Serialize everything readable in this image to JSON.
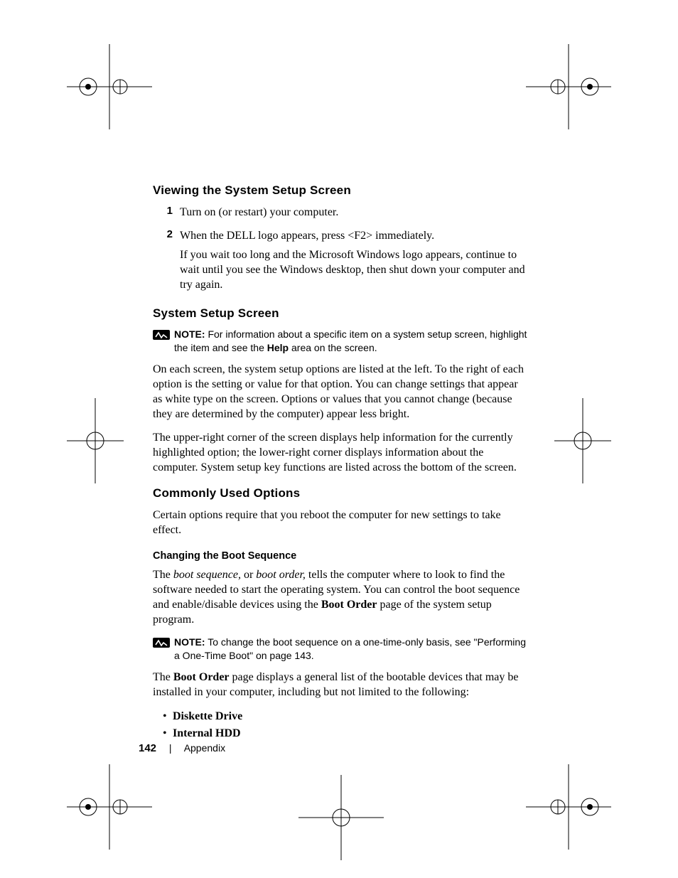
{
  "section1": {
    "heading": "Viewing the System Setup Screen",
    "items": [
      {
        "num": "1",
        "text": "Turn on (or restart) your computer."
      },
      {
        "num": "2",
        "text": "When the DELL logo appears, press <F2> immediately.",
        "tail": "If you wait too long and the Microsoft Windows logo appears, continue to wait until you see the Windows desktop, then shut down your computer and try again."
      }
    ]
  },
  "section2": {
    "heading": "System Setup Screen",
    "note": {
      "label": "NOTE:",
      "pre": " For information about a specific item on a system setup screen, highlight the item and see the ",
      "bold": "Help",
      "post": " area on the screen."
    },
    "para1": "On each screen, the system setup options are listed at the left. To the right of each option is the setting or value for that option. You can change settings that appear as white type on the screen. Options or values that you cannot change (because they are determined by the computer) appear less bright.",
    "para2": "The upper-right corner of the screen displays help information for the currently highlighted option; the lower-right corner displays information about the computer. System setup key functions are listed across the bottom of the screen."
  },
  "section3": {
    "heading": "Commonly Used Options",
    "para": "Certain options require that you reboot the computer for new settings to take effect.",
    "sub": {
      "heading": "Changing the Boot Sequence",
      "p1a": "The ",
      "p1i1": "boot sequence,",
      "p1b": " or ",
      "p1i2": "boot order,",
      "p1c": " tells the computer where to look to find the software needed to start the operating system. You can control the boot sequence and enable/disable devices using the ",
      "p1bold": "Boot Order",
      "p1d": " page of the system setup program.",
      "note": {
        "label": "NOTE:",
        "text": " To change the boot sequence on a one-time-only basis, see \"Performing a One-Time Boot\" on page 143."
      },
      "p2a": "The ",
      "p2bold": "Boot Order",
      "p2b": " page displays a general list of the bootable devices that may be installed in your computer, including but not limited to the following:",
      "bullets": [
        "Diskette Drive",
        "Internal HDD"
      ]
    }
  },
  "footer": {
    "page": "142",
    "section": "Appendix"
  }
}
